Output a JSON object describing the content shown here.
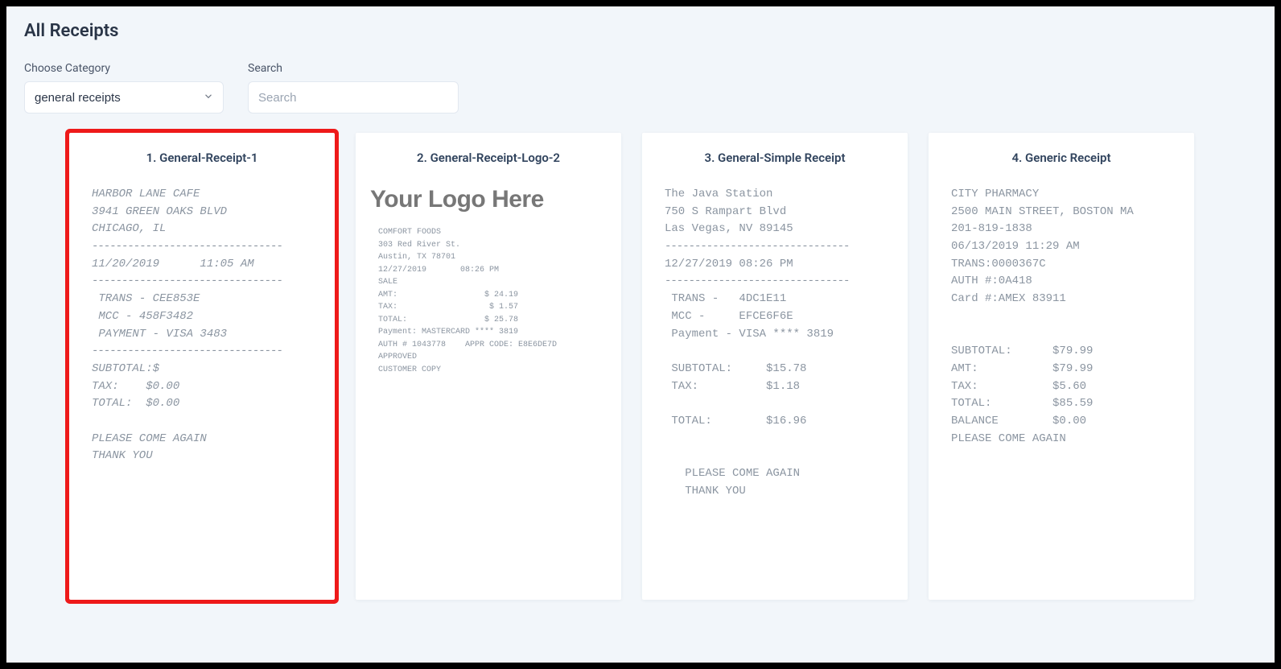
{
  "header": {
    "title": "All Receipts"
  },
  "filters": {
    "category_label": "Choose Category",
    "category_value": "general receipts",
    "search_label": "Search",
    "search_placeholder": "Search"
  },
  "cards": [
    {
      "title": "1. General-Receipt-1",
      "highlight": true,
      "style": "italic",
      "lines": [
        "HARBOR LANE CAFE",
        "3941 GREEN OAKS BLVD",
        "CHICAGO, IL",
        "--------------------------------",
        "11/20/2019      11:05 AM",
        "--------------------------------",
        " TRANS - CEE853E",
        " MCC - 458F3482",
        " PAYMENT - VISA 3483",
        "--------------------------------",
        "SUBTOTAL:$",
        "TAX:    $0.00",
        "TOTAL:  $0.00",
        "",
        "PLEASE COME AGAIN",
        "THANK YOU"
      ]
    },
    {
      "title": "2. General-Receipt-Logo-2",
      "logo": "Your Logo Here",
      "style": "small",
      "lines": [
        "COMFORT FOODS",
        "303 Red River St.",
        "Austin, TX 78701",
        "12/27/2019       08:26 PM",
        "SALE",
        "AMT:                  $ 24.19",
        "TAX:                   $ 1.57",
        "TOTAL:                $ 25.78",
        "Payment: MASTERCARD **** 3819",
        "AUTH # 1043778    APPR CODE: E8E6DE7D",
        "APPROVED",
        "CUSTOMER COPY"
      ]
    },
    {
      "title": "3. General-Simple Receipt",
      "style": "normal",
      "lines": [
        "The Java Station",
        "750 S Rampart Blvd",
        "Las Vegas, NV 89145",
        "-------------------------------",
        "12/27/2019 08:26 PM",
        "-------------------------------",
        " TRANS -   4DC1E11",
        " MCC -     EFCE6F6E",
        " Payment - VISA **** 3819",
        "",
        " SUBTOTAL:     $15.78",
        " TAX:          $1.18",
        "",
        " TOTAL:        $16.96",
        "",
        "",
        "   PLEASE COME AGAIN",
        "   THANK YOU"
      ]
    },
    {
      "title": "4. Generic Receipt",
      "style": "normal",
      "lines": [
        "CITY PHARMACY",
        "2500 MAIN STREET, BOSTON MA",
        "201-819-1838",
        "06/13/2019 11:29 AM",
        "TRANS:0000367C",
        "AUTH #:0A418",
        "Card #:AMEX 83911",
        "",
        "",
        "SUBTOTAL:      $79.99",
        "AMT:           $79.99",
        "TAX:           $5.60",
        "TOTAL:         $85.59",
        "BALANCE        $0.00",
        "PLEASE COME AGAIN"
      ]
    }
  ]
}
